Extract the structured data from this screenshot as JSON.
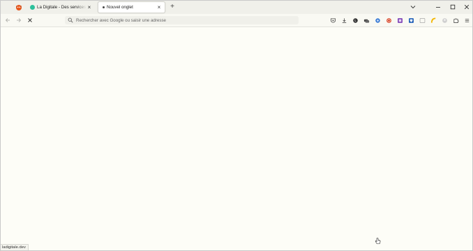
{
  "tabs": [
    {
      "title": "La Digitale - Des services libres",
      "favicon": "ladigitale-favicon",
      "active": false
    },
    {
      "title": "Nouvel onglet",
      "favicon": "newtab-dot-icon",
      "active": true
    }
  ],
  "tab_close_symbol": "×",
  "new_tab_symbol": "+",
  "urlbar": {
    "placeholder": "Rechercher avec Google ou saisir une adresse",
    "value": ""
  },
  "status_bar": {
    "text": "ladigitale.dev"
  },
  "colors": {
    "tabbar_bg": "#f0f0ea",
    "page_bg": "#fdfdf7",
    "ladigitale_favicon": "#2cc09b"
  },
  "toolbar_icons": [
    "pocket-icon",
    "download-icon",
    "lastpass-icon",
    "multi-account-icon",
    "blue-ext-icon",
    "ublock-icon",
    "purple-ext-icon",
    "bitwarden-icon",
    "gray-ext-icon",
    "yellow-ext-icon",
    "account-icon",
    "extensions-icon",
    "menu-icon"
  ]
}
